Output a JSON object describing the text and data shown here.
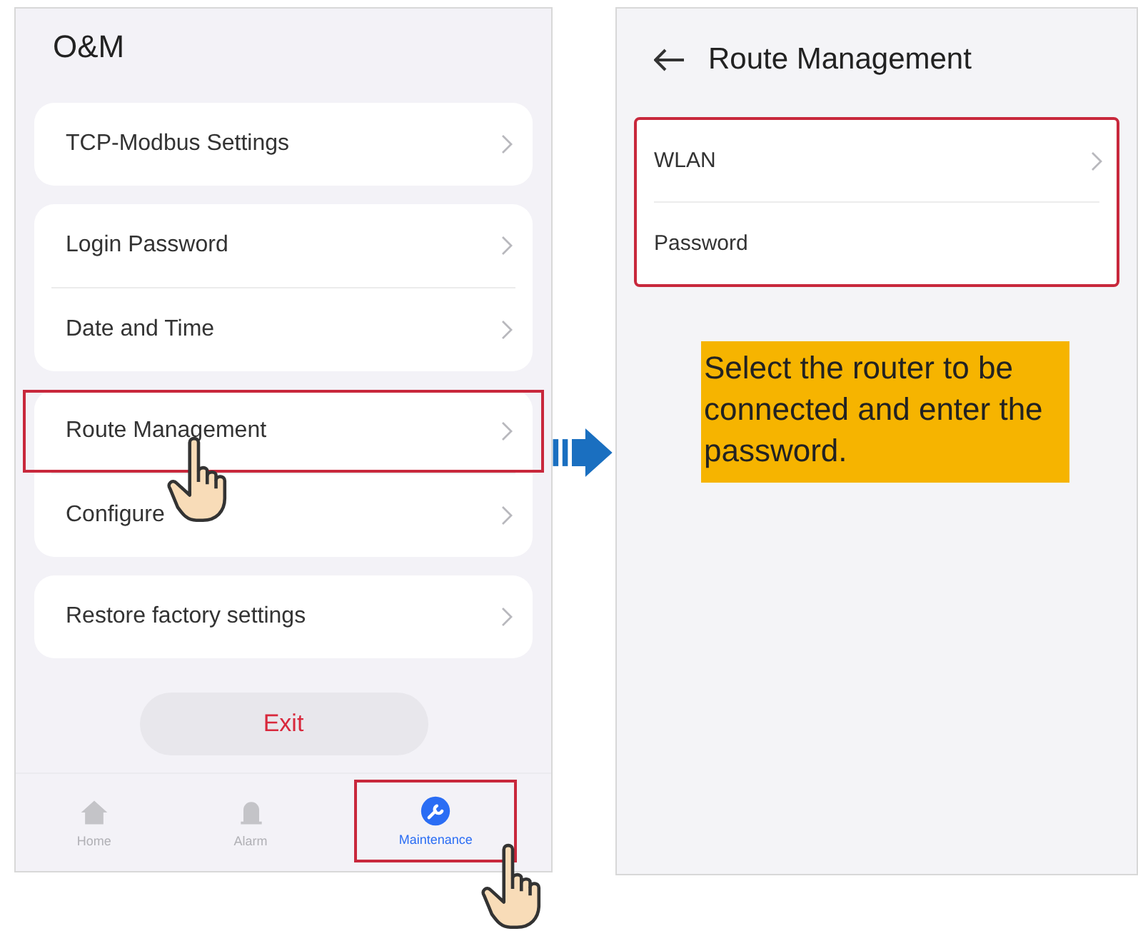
{
  "left_screen": {
    "title": "O&M",
    "groups": [
      {
        "items": [
          {
            "label": "TCP-Modbus Settings",
            "highlighted": false,
            "pointer": false
          }
        ]
      },
      {
        "items": [
          {
            "label": "Login Password",
            "highlighted": false,
            "pointer": false
          },
          {
            "label": "Date and Time",
            "highlighted": false,
            "pointer": false
          }
        ]
      },
      {
        "items": [
          {
            "label": "Route Management",
            "highlighted": true,
            "pointer": true
          },
          {
            "label": "Configure",
            "highlighted": false,
            "pointer": false
          }
        ]
      },
      {
        "items": [
          {
            "label": "Restore factory settings",
            "highlighted": false,
            "pointer": false
          }
        ]
      }
    ],
    "exit_button": "Exit",
    "nav_tabs": [
      {
        "label": "Home",
        "kind": "home",
        "selected": false,
        "highlighted": false
      },
      {
        "label": "Alarm",
        "kind": "alarm",
        "selected": false,
        "highlighted": false
      },
      {
        "label": "Maintenance",
        "kind": "maintenance",
        "selected": true,
        "highlighted": true
      }
    ]
  },
  "right_screen": {
    "title": "Route Management",
    "highlighted": true,
    "items": [
      {
        "label": "WLAN",
        "chevron": true
      },
      {
        "label": "Password",
        "chevron": false
      }
    ],
    "callout": "Select the router to be connected and enter the password."
  }
}
